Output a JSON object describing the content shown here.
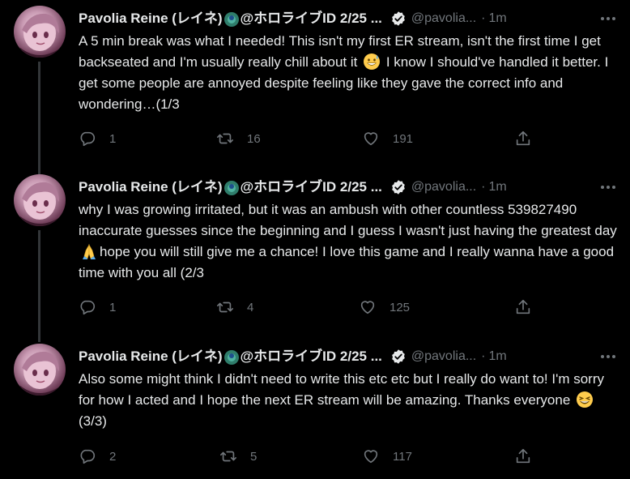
{
  "tweets": [
    {
      "display_name": "Pavolia Reine (レイネ)",
      "name_suffix": "@ホロライブID 2/25 ...",
      "handle": "@pavolia...",
      "separator": "·",
      "time": "1m",
      "text_parts": [
        "A 5 min break was what I needed! This isn't my first ER stream, isn't the first time I get backseated and I'm usually really chill about it ",
        " I know I should've handled it better. I get some people are annoyed despite feeling like they gave the correct info and wondering…(1/3"
      ],
      "inline_emoji": "grinning-sweat-emoji",
      "replies": "1",
      "retweets": "16",
      "likes": "191"
    },
    {
      "display_name": "Pavolia Reine (レイネ)",
      "name_suffix": "@ホロライブID 2/25 ...",
      "handle": "@pavolia...",
      "separator": "·",
      "time": "1m",
      "text_parts": [
        "why I was growing irritated, but it was an ambush with other countless 539827490 inaccurate guesses since the beginning and I guess I wasn't just having the greatest day",
        "hope you will still give me a chance! I love this game and I really wanna have a good time with you all (2/3"
      ],
      "inline_emoji": "folded-hands-emoji",
      "replies": "1",
      "retweets": "4",
      "likes": "125"
    },
    {
      "display_name": "Pavolia Reine (レイネ)",
      "name_suffix": "@ホロライブID 2/25 ...",
      "handle": "@pavolia...",
      "separator": "·",
      "time": "1m",
      "text_parts": [
        "Also some might think I didn't need to write this etc etc but I really do want to! I'm sorry for how I acted and I hope the next ER stream will be amazing. Thanks everyone ",
        "(3/3)"
      ],
      "inline_emoji": "laughing-emoji",
      "replies": "2",
      "retweets": "5",
      "likes": "117"
    }
  ],
  "colors": {
    "background": "#000000",
    "text": "#e7e9ea",
    "muted": "#71767b",
    "thread_line": "#333639"
  }
}
